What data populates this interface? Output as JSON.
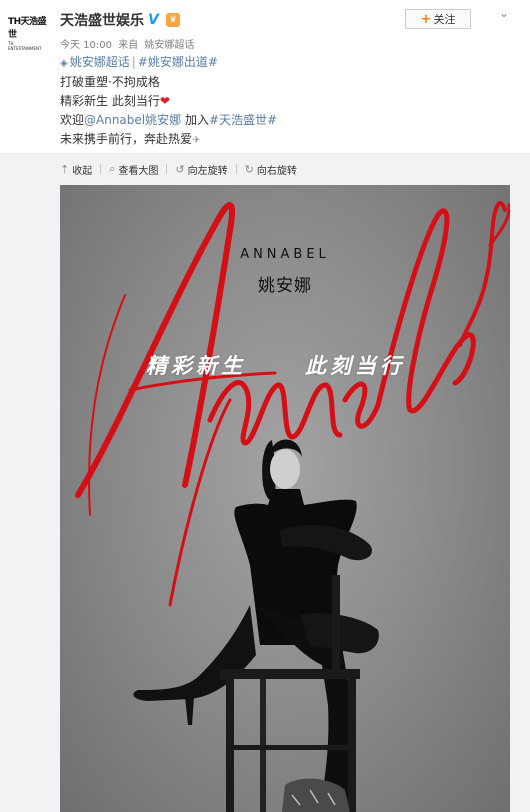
{
  "account": {
    "name": "天浩盛世娱乐",
    "logo_text": "TH天浩盛世",
    "logo_sub": "TH ENTERTAINMENT",
    "verified_icon": "verified-v-icon",
    "member_icon": "vip-crown-icon"
  },
  "follow_button": {
    "label": "关注"
  },
  "meta": {
    "time": "今天 10:00",
    "source_prefix": "来自",
    "source": "姚安娜超话"
  },
  "post": {
    "supertopic": "姚安娜超话",
    "topic": "#姚安娜出道#",
    "line1": "打破重塑·不拘成格",
    "line2": "精彩新生 此刻当行",
    "line3_prefix": "欢迎",
    "mention": "@Annabel姚安娜",
    "line3_mid": " 加入",
    "topic2": "#天浩盛世#",
    "line4": "未来携手前行，奔赴热爱"
  },
  "toolbar": {
    "collapse": "收起",
    "view_large": "查看大图",
    "rotate_left": "向左旋转",
    "rotate_right": "向右旋转"
  },
  "poster": {
    "brand_en": "ANNABEL",
    "brand_cn": "姚安娜",
    "script": "Annabel",
    "slogan_a": "精彩新生",
    "slogan_b": "此刻当行"
  },
  "colors": {
    "link": "#5a7ea8",
    "follow_plus": "#ff8200",
    "verified": "#1e9cf0",
    "script_red": "#d40f16"
  }
}
